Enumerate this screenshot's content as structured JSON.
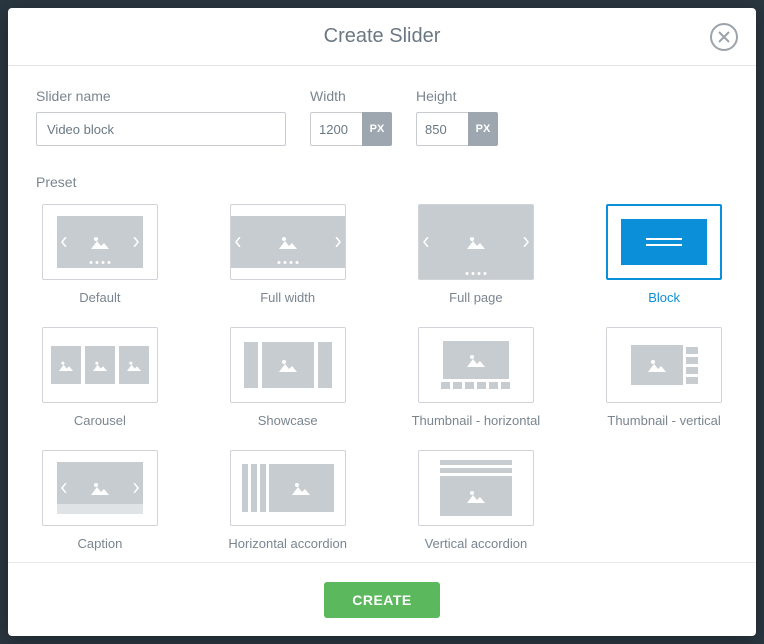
{
  "modal": {
    "title": "Create Slider",
    "close_label": "Close"
  },
  "form": {
    "name_label": "Slider name",
    "name_value": "Video block",
    "width_label": "Width",
    "width_value": "1200",
    "height_label": "Height",
    "height_value": "850",
    "unit": "PX"
  },
  "preset": {
    "label": "Preset",
    "selected": "block",
    "items": [
      {
        "id": "default",
        "label": "Default"
      },
      {
        "id": "full-width",
        "label": "Full width"
      },
      {
        "id": "full-page",
        "label": "Full page"
      },
      {
        "id": "block",
        "label": "Block"
      },
      {
        "id": "carousel",
        "label": "Carousel"
      },
      {
        "id": "showcase",
        "label": "Showcase"
      },
      {
        "id": "thumb-horizontal",
        "label": "Thumbnail - horizontal"
      },
      {
        "id": "thumb-vertical",
        "label": "Thumbnail - vertical"
      },
      {
        "id": "caption",
        "label": "Caption"
      },
      {
        "id": "h-accordion",
        "label": "Horizontal accordion"
      },
      {
        "id": "v-accordion",
        "label": "Vertical accordion"
      }
    ]
  },
  "actions": {
    "create": "CREATE"
  },
  "colors": {
    "accent": "#0b8fd8",
    "primary_button": "#5cb85c",
    "thumb_fill": "#c7ccd0"
  }
}
